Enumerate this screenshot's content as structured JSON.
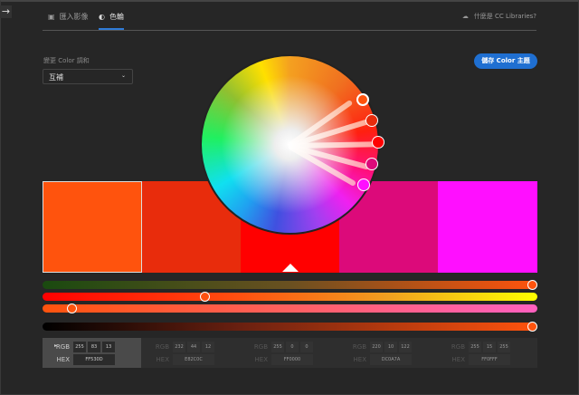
{
  "tabs": [
    {
      "label": "匯入影像",
      "icon": "image-icon"
    },
    {
      "label": "色輪",
      "icon": "color-wheel-icon",
      "active": true
    }
  ],
  "libraries_link": "什麼是 CC Libraries?",
  "harmony_label": "變更 Color 調和",
  "harmony_value": "互補",
  "save_button": "儲存 Color 主題",
  "swatches": [
    {
      "hex": "FF530D",
      "rgb": [
        "255",
        "83",
        "13"
      ],
      "color": "#FF530D",
      "selected": true
    },
    {
      "hex": "E82C0C",
      "rgb": [
        "232",
        "44",
        "12"
      ],
      "color": "#E82C0C"
    },
    {
      "hex": "FF0000",
      "rgb": [
        "255",
        "0",
        "0"
      ],
      "color": "#FF0000"
    },
    {
      "hex": "DC0A7A",
      "rgb": [
        "220",
        "10",
        "122"
      ],
      "color": "#DC0A7A"
    },
    {
      "hex": "FF0FFF",
      "rgb": [
        "255",
        "15",
        "255"
      ],
      "color": "#FF0FFF"
    }
  ],
  "labels": {
    "rgb": "RGB",
    "hex": "HEX"
  },
  "accent": "#1f6fd1"
}
